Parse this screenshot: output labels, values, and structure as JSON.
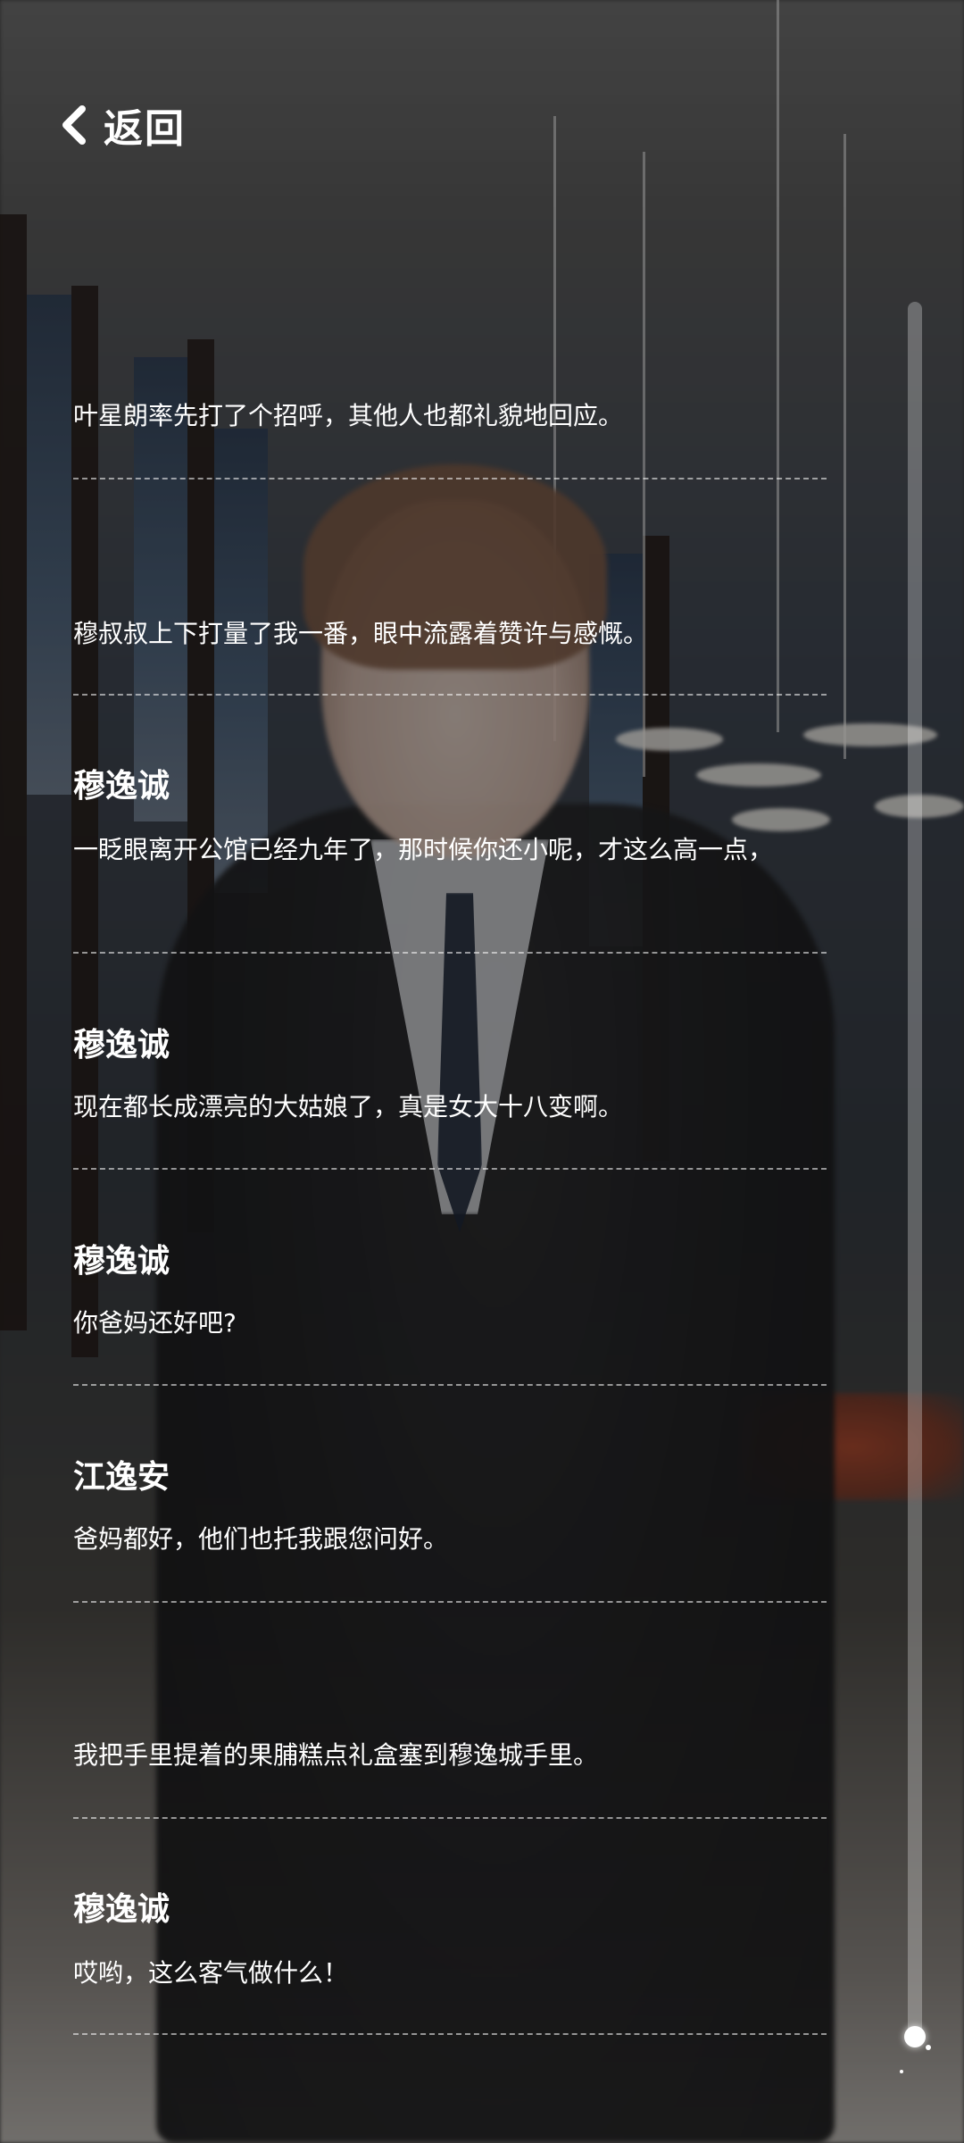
{
  "header": {
    "back_label": "返回"
  },
  "dialogue": [
    {
      "speaker": "",
      "text": "叶星朗率先打了个招呼，其他人也都礼貌地回应。"
    },
    {
      "speaker": "",
      "text": "穆叔叔上下打量了我一番，眼中流露着赞许与感慨。"
    },
    {
      "speaker": "穆逸诚",
      "text": "一眨眼离开公馆已经九年了，那时候你还小呢，才这么高一点，"
    },
    {
      "speaker": "穆逸诚",
      "text": "现在都长成漂亮的大姑娘了，真是女大十八变啊。"
    },
    {
      "speaker": "穆逸诚",
      "text": "你爸妈还好吧?"
    },
    {
      "speaker": "江逸安",
      "text": "爸妈都好，他们也托我跟您问好。"
    },
    {
      "speaker": "",
      "text": "我把手里提着的果脯糕点礼盒塞到穆逸城手里。"
    },
    {
      "speaker": "穆逸诚",
      "text": "哎哟，这么客气做什么！"
    }
  ],
  "scroll": {
    "position": 1.0
  },
  "colors": {
    "text": "#ffffff",
    "divider": "rgba(255,255,255,0.55)",
    "overlay": "rgba(0,0,0,0.38)"
  },
  "icons": {
    "back": "chevron-left-icon"
  }
}
